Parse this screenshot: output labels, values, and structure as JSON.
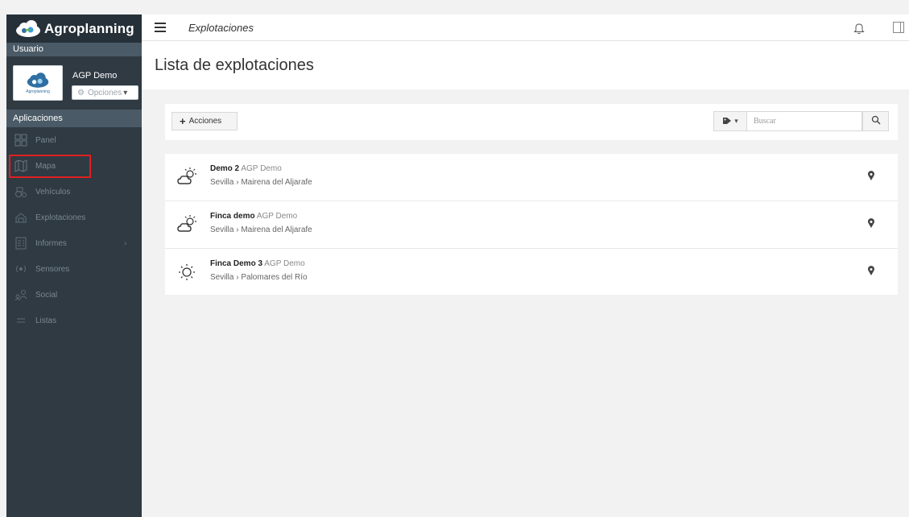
{
  "brand": {
    "name": "Agroplanning",
    "logo_text": "Agroplanning"
  },
  "sidebar": {
    "user_section_label": "Usuario",
    "user_name": "AGP Demo",
    "options_label": "Opciones",
    "apps_section_label": "Aplicaciones",
    "items": [
      {
        "label": "Panel",
        "icon": "dashboard-icon"
      },
      {
        "label": "Mapa",
        "icon": "map-icon"
      },
      {
        "label": "Vehículos",
        "icon": "vehicle-icon"
      },
      {
        "label": "Explotaciones",
        "icon": "farm-icon"
      },
      {
        "label": "Informes",
        "icon": "report-icon",
        "has_submenu": true
      },
      {
        "label": "Sensores",
        "icon": "sensor-icon"
      },
      {
        "label": "Social",
        "icon": "social-icon"
      },
      {
        "label": "Listas",
        "icon": "list-icon"
      }
    ]
  },
  "topbar": {
    "breadcrumb": "Explotaciones"
  },
  "page": {
    "title": "Lista de explotaciones"
  },
  "actions": {
    "button_label": "Acciones",
    "search_placeholder": "Buscar"
  },
  "farms": [
    {
      "name": "Demo 2",
      "owner": "AGP Demo",
      "location": "Sevilla › Mairena del Aljarafe",
      "weather": "partly-cloudy"
    },
    {
      "name": "Finca demo",
      "owner": "AGP Demo",
      "location": "Sevilla › Mairena del Aljarafe",
      "weather": "partly-cloudy"
    },
    {
      "name": "Finca Demo 3",
      "owner": "AGP Demo",
      "location": "Sevilla › Palomares del Río",
      "weather": "sunny"
    }
  ],
  "colors": {
    "sidebar_bg": "#2f3a43",
    "brand_bg": "#263038",
    "highlight": "#e02020",
    "accent": "#2f6fa3"
  }
}
